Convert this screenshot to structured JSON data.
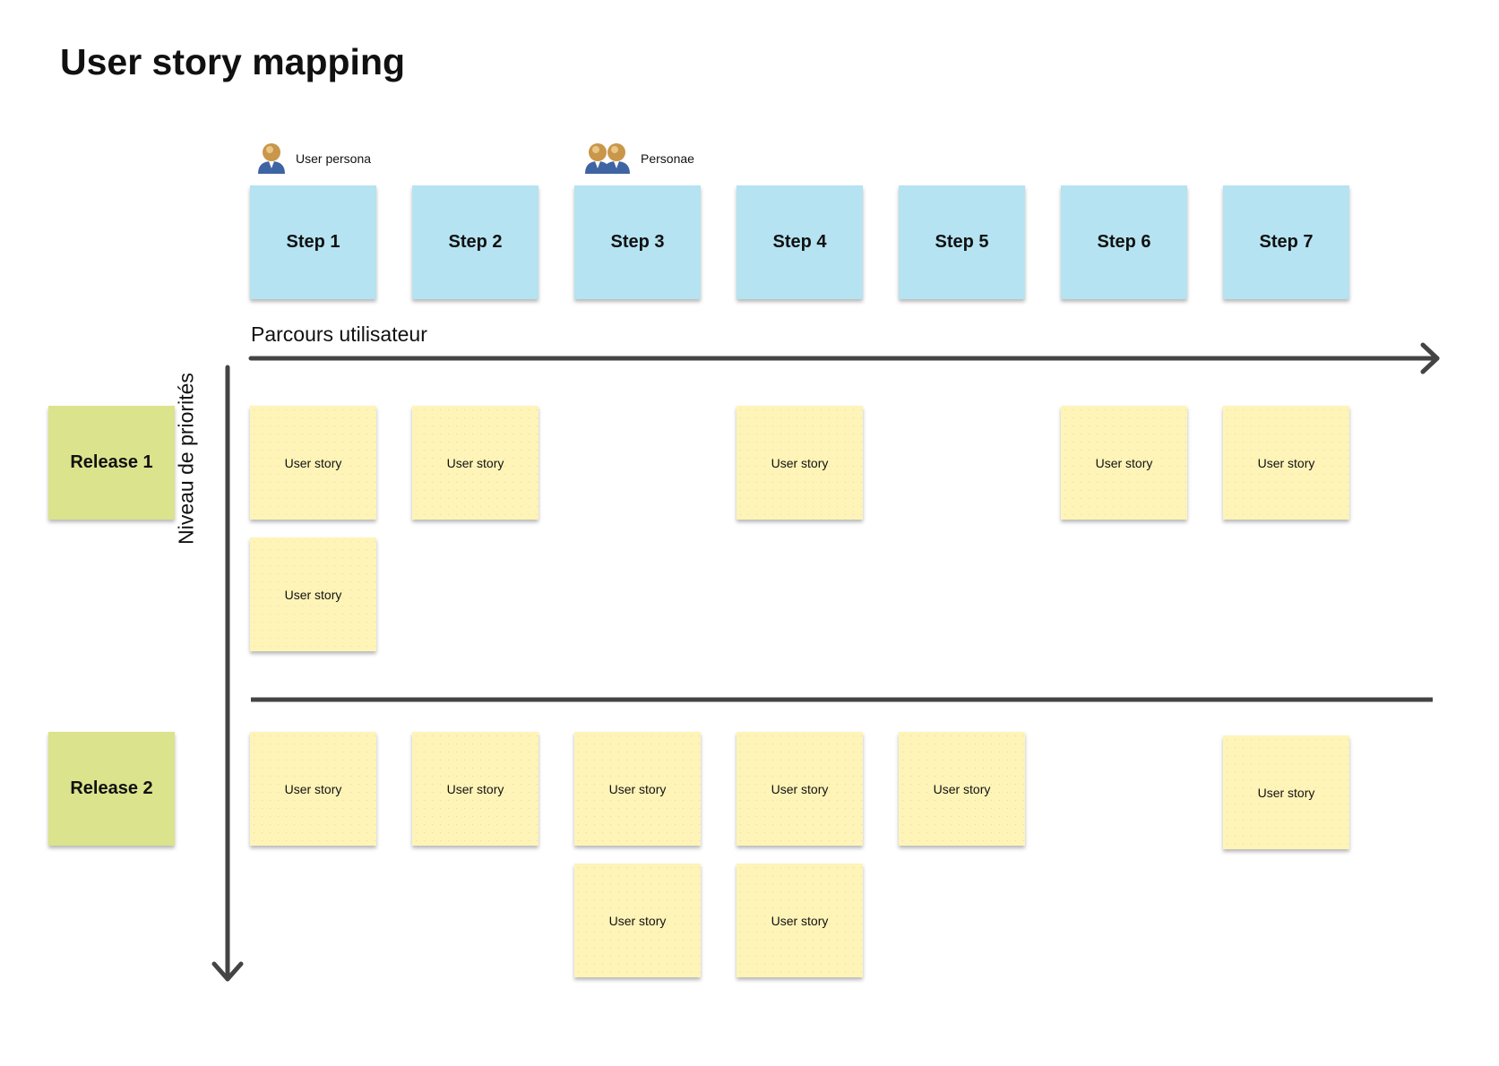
{
  "title": "User story mapping",
  "personas": [
    {
      "label": "User persona",
      "icon": "user-persona-icon"
    },
    {
      "label": "Personae",
      "icon": "personae-group-icon"
    }
  ],
  "steps": [
    "Step 1",
    "Step 2",
    "Step 3",
    "Step 4",
    "Step 5",
    "Step 6",
    "Step 7"
  ],
  "axes": {
    "horizontal_label": "Parcours utilisateur",
    "vertical_label": "Niveau de priorités"
  },
  "releases": [
    {
      "label": "Release 1",
      "rows": [
        [
          "User story",
          "User story",
          null,
          "User story",
          null,
          "User story",
          "User story"
        ],
        [
          "User story",
          null,
          null,
          null,
          null,
          null,
          null
        ]
      ]
    },
    {
      "label": "Release 2",
      "rows": [
        [
          "User story",
          "User story",
          "User story",
          "User story",
          "User story",
          null,
          "User story"
        ],
        [
          null,
          null,
          "User story",
          "User story",
          null,
          null,
          null
        ]
      ]
    }
  ],
  "colors": {
    "step": "#b5e3f2",
    "story": "#fff4b8",
    "release": "#dbe38c",
    "line": "#444444"
  }
}
